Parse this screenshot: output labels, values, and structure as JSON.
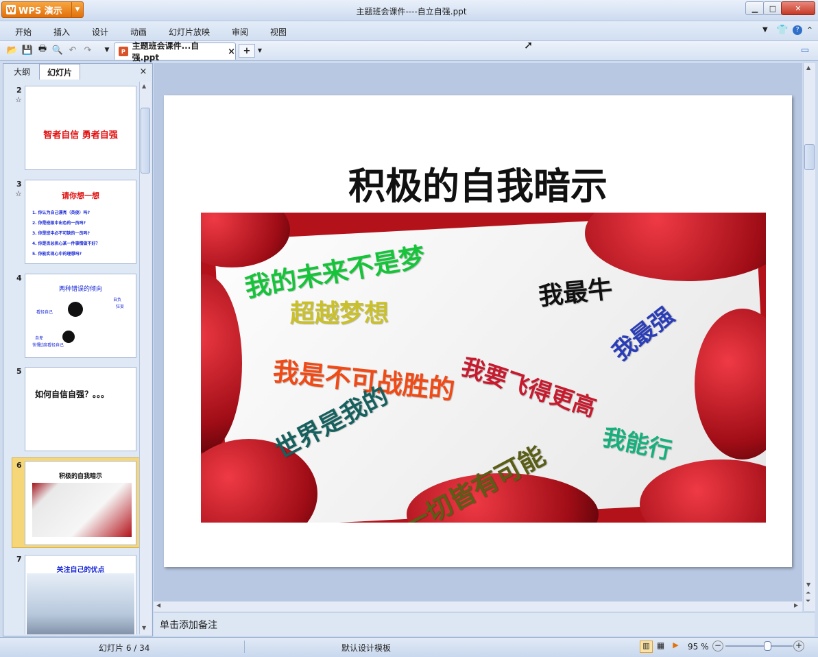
{
  "app": {
    "name": "WPS 演示",
    "window_title": "主题班会课件----自立自强.ppt"
  },
  "menu": [
    "开始",
    "插入",
    "设计",
    "动画",
    "幻灯片放映",
    "审阅",
    "视图"
  ],
  "doc_tab": {
    "label": "主题班会课件...自强.ppt",
    "close": "×",
    "new": "+"
  },
  "panel": {
    "tabs": [
      "大纲",
      "幻灯片"
    ],
    "active_tab": "幻灯片",
    "close": "×"
  },
  "thumbnails": [
    {
      "num": "2",
      "starred": true,
      "title": "智者自信  勇者自强"
    },
    {
      "num": "3",
      "starred": true,
      "title": "请你想一想",
      "bullets": [
        "1. 你认为自己漂亮（英俊）吗?",
        "2. 你是班级中出色的一员吗?",
        "3. 你是班中必不可缺的一员吗?",
        "4. 你是否总担心某一件事情做不好？",
        "5. 你能实现心中的理想吗?"
      ]
    },
    {
      "num": "4",
      "starred": false,
      "title": "两种错误的倾向",
      "labels": [
        "自负",
        "狂妄",
        "看轻自己",
        "自卑",
        "怯懦",
        "过度看轻自己"
      ]
    },
    {
      "num": "5",
      "starred": false,
      "title": "如何自信自强？。。。"
    },
    {
      "num": "6",
      "starred": false,
      "title": "积极的自我暗示",
      "selected": true
    },
    {
      "num": "7",
      "starred": false,
      "title": "关注自己的优点"
    }
  ],
  "slide": {
    "title": "积极的自我暗示",
    "phrases": [
      "我的未来不是梦",
      "超越梦想",
      "我最牛",
      "我最强",
      "我要飞得更高",
      "我是不可战胜的",
      "世界是我的",
      "一切皆有可能",
      "我能行"
    ]
  },
  "notes": {
    "placeholder": "单击添加备注"
  },
  "status": {
    "slide_indicator": "幻灯片 6 / 34",
    "template": "默认设计模板",
    "zoom": "95 %",
    "zoom_level": 95
  },
  "colors": {
    "accent": "#e2700c",
    "selection": "#f5d77a",
    "titlebar": "#d6e2f3"
  }
}
